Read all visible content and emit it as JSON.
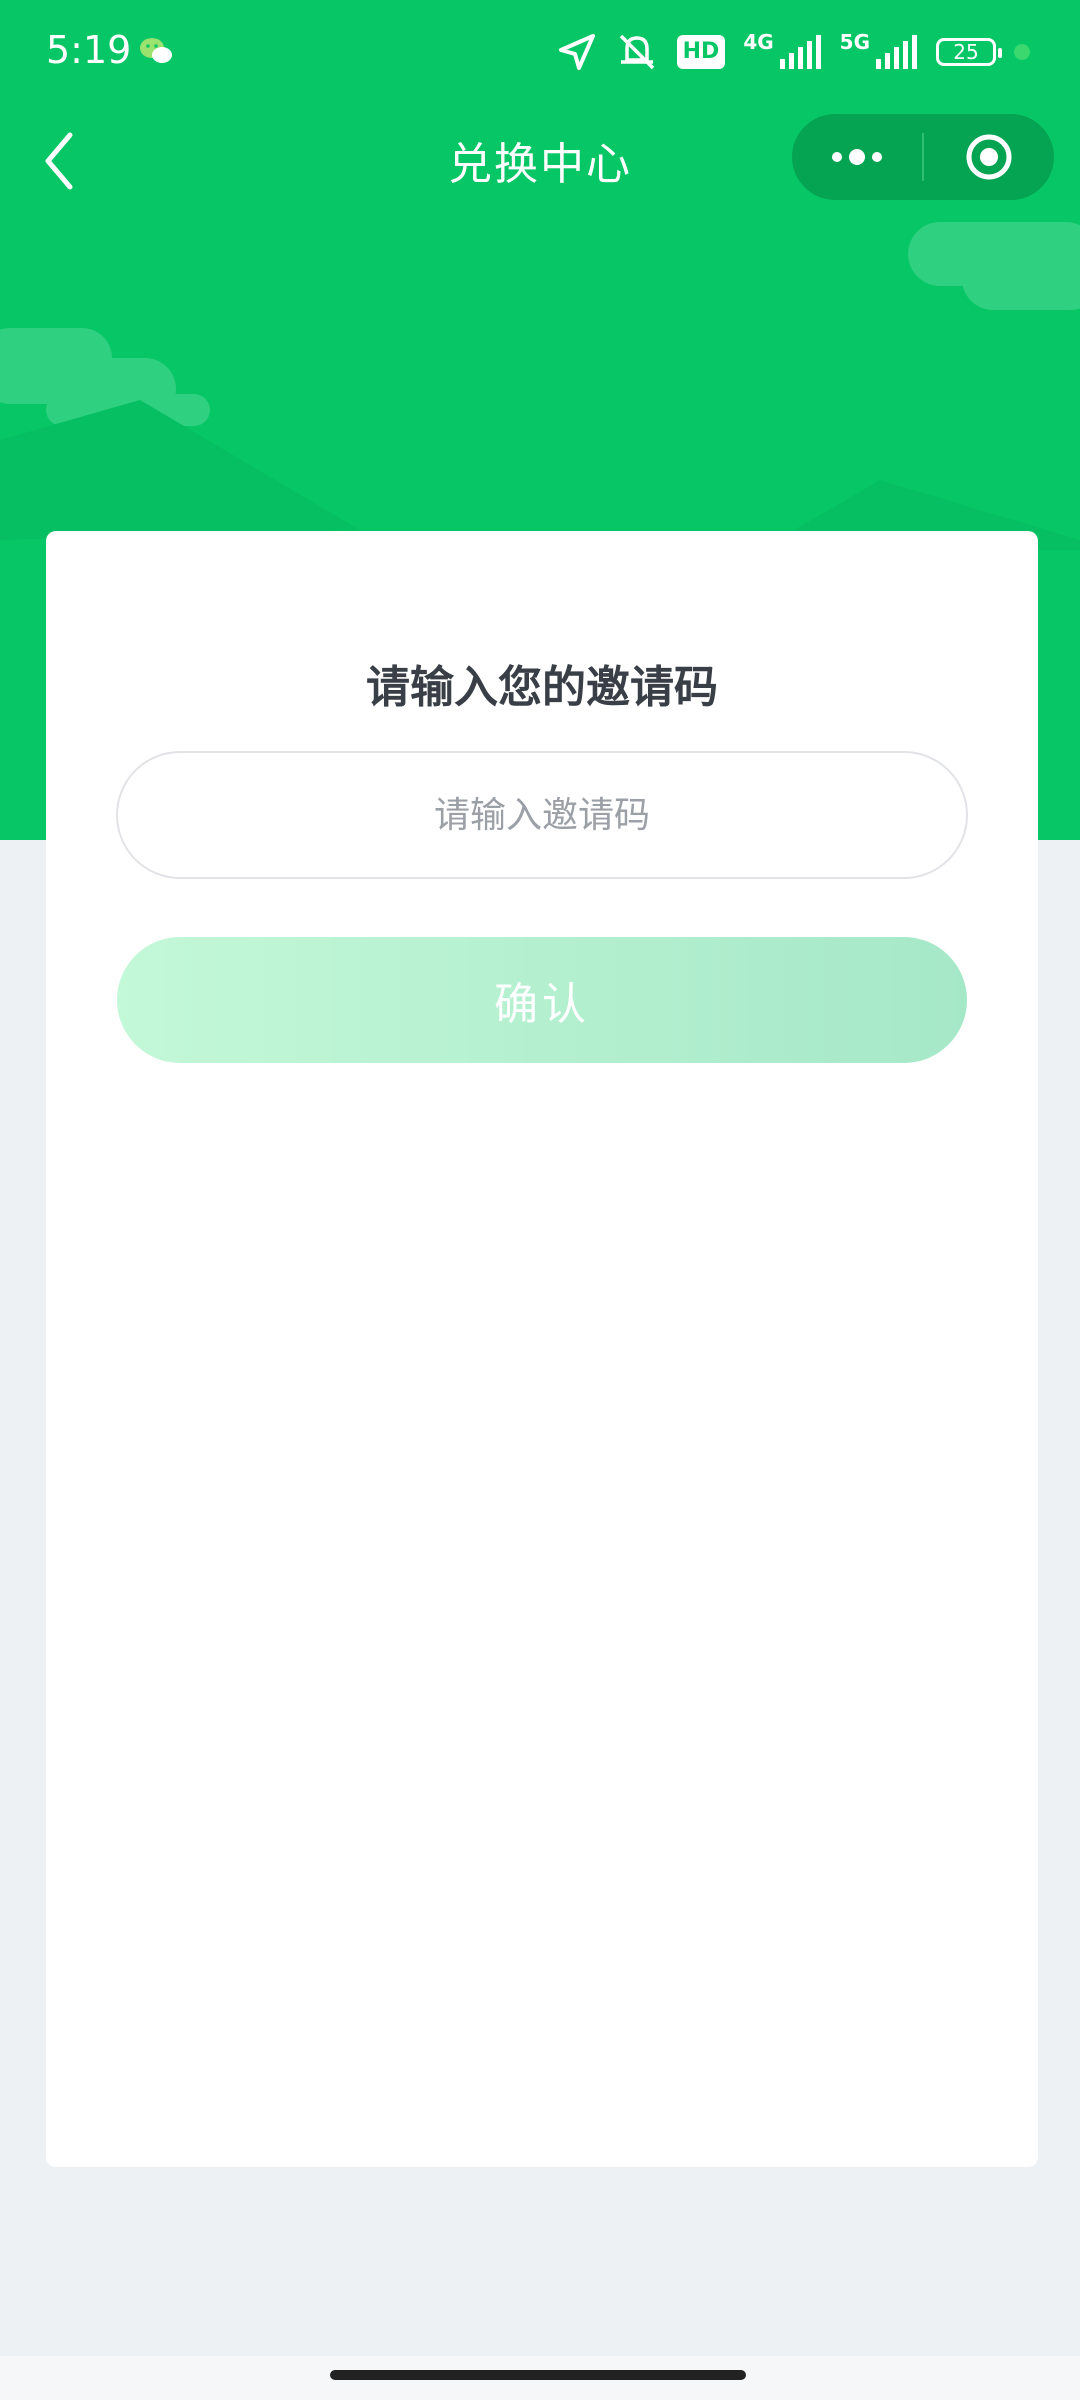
{
  "status_bar": {
    "time": "5:19",
    "hd_label": "HD",
    "network_1": "4G",
    "network_2": "5G",
    "battery": "25"
  },
  "nav": {
    "title": "兑换中心"
  },
  "card": {
    "title": "请输入您的邀请码",
    "input_value": "",
    "input_placeholder": "请输入邀请码",
    "confirm_label": "确认"
  },
  "colors": {
    "brand_green": "#07c665",
    "capsule_green": "#05a453",
    "button_gradient_start": "#c3f8d8",
    "button_gradient_end": "#a5e8c8"
  },
  "icons": [
    "wechat-icon",
    "location-icon",
    "mute-icon",
    "signal-icon",
    "battery-icon",
    "back-icon",
    "more-icon",
    "close-target-icon"
  ]
}
